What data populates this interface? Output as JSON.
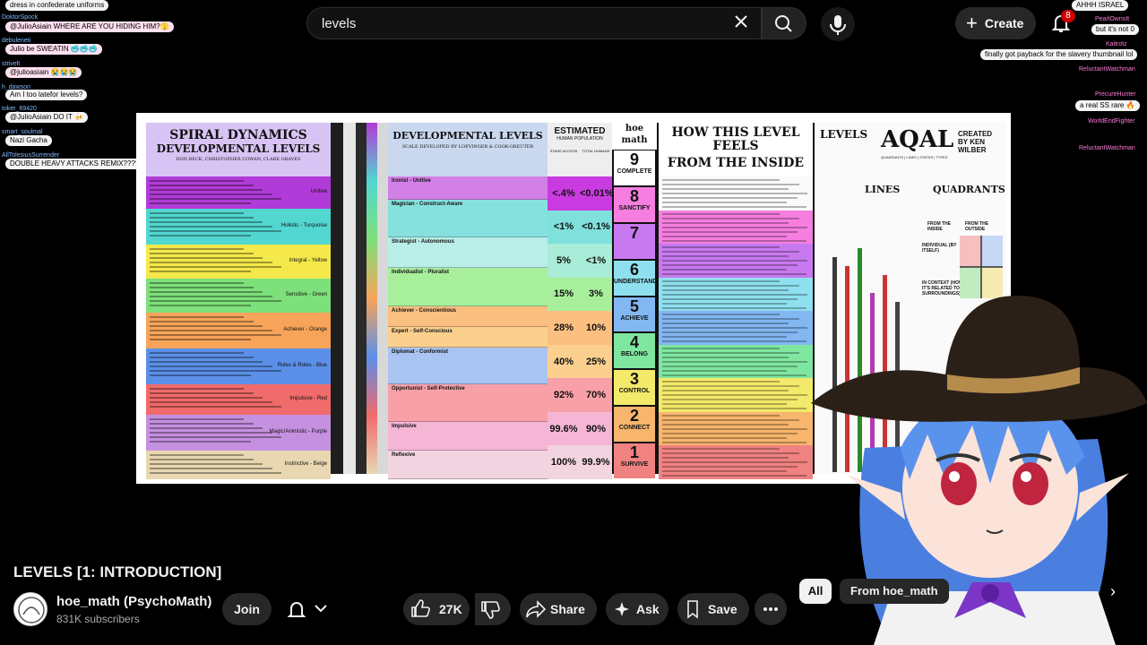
{
  "search": {
    "value": "levels"
  },
  "header": {
    "create_label": "Create",
    "notification_count": "8"
  },
  "chat_left": [
    {
      "name": "",
      "text": "dress in confederate uniforms"
    },
    {
      "name": "DoktorSpock",
      "text": "@JulioAsiain WHERE ARE YOU HIDING HIM?🫣"
    },
    {
      "name": "debuleneti",
      "text": "Julio be SWEATIN 🥶🥶🥶"
    },
    {
      "name": "strivelt",
      "text": "@julioasiain 😭😭😭"
    },
    {
      "name": "h_dawson",
      "text": "Am I too latefor levels?"
    },
    {
      "name": "toker_69420",
      "text": "@JulioAsiain DO IT 🍻"
    },
    {
      "name": "smart_soulmal",
      "text": "Nazi Gacha"
    },
    {
      "name": "AllTolesiusSurrender",
      "text": "DOUBLE HEAVY ATTACKS REMIX????????"
    }
  ],
  "chat_right": [
    {
      "name": "",
      "text": "AHHH ISRAEL"
    },
    {
      "name": "PearlOwnsIt",
      "text": "but it's not 0"
    },
    {
      "name": "Kaitrotz",
      "text": "finally got payback for the slavery thumbnail lol"
    },
    {
      "name": "ReluctantWatchman",
      "text": ""
    },
    {
      "name": "PrecureHunter",
      "text": "a real SS rare 🔥"
    },
    {
      "name": "WorldEndFighter",
      "text": ""
    },
    {
      "name": "ReluctantWatchman",
      "text": ""
    }
  ],
  "chart": {
    "spiral_title_1": "SPIRAL DYNAMICS",
    "spiral_title_2": "DEVELOPMENTAL LEVELS",
    "spiral_authors": "DON BECK, CHRISTOPHER COWAN, CLARE GRAVES",
    "spiral_bands": [
      {
        "label": "Unitive",
        "color": "#b13bd8"
      },
      {
        "label": "Holistic - Turquoise",
        "color": "#52d7d0"
      },
      {
        "label": "Integral - Yellow",
        "color": "#f5e84a"
      },
      {
        "label": "Sensitive - Green",
        "color": "#7ee07a"
      },
      {
        "label": "Achiever - Orange",
        "color": "#f7a45a"
      },
      {
        "label": "Rules & Roles - Blue",
        "color": "#5b8fe8"
      },
      {
        "label": "Impulsive - Red",
        "color": "#f06b6b"
      },
      {
        "label": "Magic/Animistic - Purple",
        "color": "#c690e0"
      },
      {
        "label": "Instinctive - Beige",
        "color": "#e8d7b0"
      }
    ],
    "dev_title": "DEVELOPMENTAL LEVELS",
    "dev_sub": "SCALE DEVELOPED BY LOEVINGER & COOK-GREUTER",
    "dev_rows": [
      {
        "name": "Ironist - Unitive",
        "color": "#d27fe6"
      },
      {
        "name": "Magician - Construct-Aware",
        "color": "#86e1de"
      },
      {
        "name": "Strategist - Autonomous",
        "color": "#b9eee8"
      },
      {
        "name": "Individualist - Pluralist",
        "color": "#a8ef9c"
      },
      {
        "name": "Achiever - Conscientious",
        "color": "#fbbf80"
      },
      {
        "name": "Expert - Self-Conscious",
        "color": "#fbd08e"
      },
      {
        "name": "Diplomat - Conformist",
        "color": "#a9c4f2"
      },
      {
        "name": "Opportunist - Self-Protective",
        "color": "#f8a0a8"
      },
      {
        "name": "Impulsive",
        "color": "#f4b6d4"
      },
      {
        "name": "Reflexive",
        "color": "#f2d4e0"
      }
    ],
    "pop_title_1": "ESTIMATED",
    "pop_title_2": "HUMAN POPULATION",
    "pop_col_a": "STAGE ACCESS",
    "pop_col_b": "TOTAL HUMANS",
    "pop_rows": [
      {
        "a": "<.4%",
        "b": "<0.01%"
      },
      {
        "a": "<1%",
        "b": "<0.1%"
      },
      {
        "a": "5%",
        "b": "<1%"
      },
      {
        "a": "15%",
        "b": "3%"
      },
      {
        "a": "28%",
        "b": "10%"
      },
      {
        "a": "40%",
        "b": "25%"
      },
      {
        "a": "92%",
        "b": "70%"
      },
      {
        "a": "99.6%",
        "b": "90%"
      },
      {
        "a": "100%",
        "b": "99.9%"
      }
    ],
    "hoe_head": "hoe math",
    "levels": [
      {
        "n": "9",
        "w": "COMPLETE",
        "color": "#ffffff"
      },
      {
        "n": "8",
        "w": "SANCTIFY",
        "color": "#f57ee0"
      },
      {
        "n": "7",
        "w": "",
        "color": "#c879ef"
      },
      {
        "n": "6",
        "w": "UNDERSTAND",
        "color": "#8fe0ef"
      },
      {
        "n": "5",
        "w": "ACHIEVE",
        "color": "#83b7f2"
      },
      {
        "n": "4",
        "w": "BELONG",
        "color": "#7fe6a0"
      },
      {
        "n": "3",
        "w": "CONTROL",
        "color": "#f3e96a"
      },
      {
        "n": "2",
        "w": "CONNECT",
        "color": "#f7b56d"
      },
      {
        "n": "1",
        "w": "SURVIVE",
        "color": "#f08282"
      }
    ],
    "how_title_1": "HOW THIS LEVEL FEELS",
    "how_title_2": "FROM THE INSIDE",
    "aqal_levels_title": "LEVELS",
    "aqal_title": "AQAL",
    "aqal_by": "CREATED BY KEN WILBER",
    "aqal_sub": "QUADRANTS | LINES | STATES | TYPES",
    "aqal_lines": "LINES",
    "aqal_quadrants": "QUADRANTS",
    "aqal_from_inside": "FROM THE INSIDE",
    "aqal_from_outside": "FROM THE OUTSIDE",
    "aqal_individual": "INDIVIDUAL (BY ITSELF)",
    "aqal_context": "IN CONTEXT (HOW IT'S RELATED TO SURROUNDINGS)"
  },
  "video": {
    "title": "LEVELS [1: INTRODUCTION]",
    "channel": "hoe_math (PsychoMath)",
    "subscribers": "831K subscribers",
    "join": "Join",
    "likes": "27K",
    "share": "Share",
    "ask": "Ask",
    "save": "Save"
  },
  "chips": {
    "all": "All",
    "from": "From hoe_math"
  },
  "colors": {
    "accent": "#cc0000",
    "pill_bg": "#272727",
    "page_bg": "#000000"
  }
}
